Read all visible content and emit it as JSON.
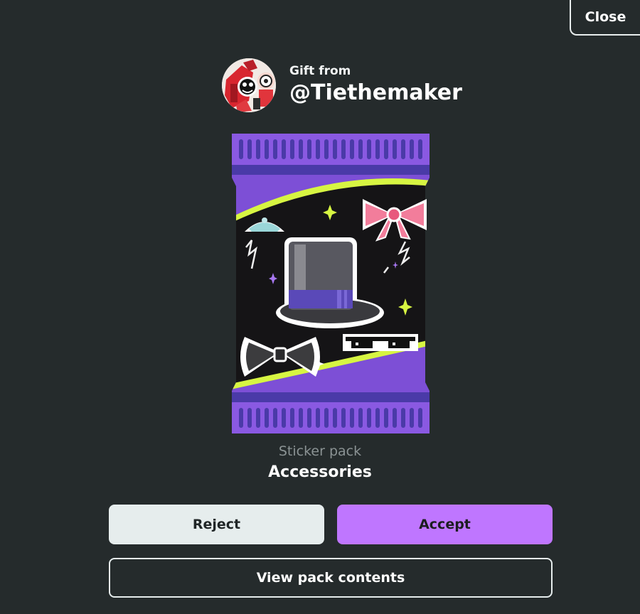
{
  "header": {
    "close_label": "Close"
  },
  "sender": {
    "prefix": "Gift from",
    "username": "@Tiethemaker"
  },
  "pack": {
    "type": "Sticker pack",
    "name": "Accessories"
  },
  "actions": {
    "reject_label": "Reject",
    "accept_label": "Accept",
    "view_contents_label": "View pack contents"
  },
  "colors": {
    "background": "#252b2c",
    "accent": "#bf76ff",
    "reject_bg": "#e6eded",
    "pack_purple": "#7d4fd6",
    "pack_lime": "#d7f542"
  },
  "icons": {
    "avatar": "user-avatar",
    "stickers": [
      "top-hat-sticker",
      "pink-bow-sticker",
      "tiara-sticker",
      "bow-tie-sticker",
      "pixel-sunglasses-sticker",
      "sparkle-icon"
    ]
  }
}
